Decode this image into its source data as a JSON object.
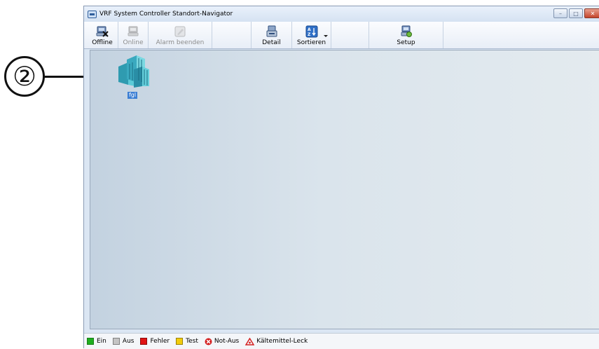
{
  "callout": {
    "number": "②"
  },
  "window": {
    "title": "VRF System Controller Standort-Navigator",
    "controls": [
      "minimize",
      "maximize",
      "close"
    ]
  },
  "toolbar": {
    "buttons": [
      {
        "label": "Offline",
        "icon": "network-disconnect-icon",
        "enabled": true
      },
      {
        "label": "Online",
        "icon": "network-connect-icon",
        "enabled": false
      },
      {
        "label": "Alarm beenden",
        "icon": "alarm-stop-icon",
        "enabled": false
      },
      {
        "label": "Detail",
        "icon": "detail-icon",
        "enabled": true
      },
      {
        "label": "Sortieren",
        "icon": "sort-az-icon",
        "enabled": true,
        "has_dropdown": true
      },
      {
        "label": "Setup",
        "icon": "setup-icon",
        "enabled": true
      }
    ]
  },
  "sites": [
    {
      "label": "fgl",
      "icon": "building-icon",
      "selected": true
    }
  ],
  "legend": {
    "items": [
      {
        "label": "Ein",
        "color": "#1fae1f"
      },
      {
        "label": "Aus",
        "color": "#c4c4c4"
      },
      {
        "label": "Fehler",
        "color": "#e01414"
      },
      {
        "label": "Test",
        "color": "#f2cc0c"
      },
      {
        "label": "Not-Aus",
        "icon": "emergency-stop-icon",
        "color": "#d42020"
      },
      {
        "label": "Kältemittel-Leck",
        "icon": "refrigerant-leak-icon",
        "color": "#d42020"
      }
    ]
  }
}
